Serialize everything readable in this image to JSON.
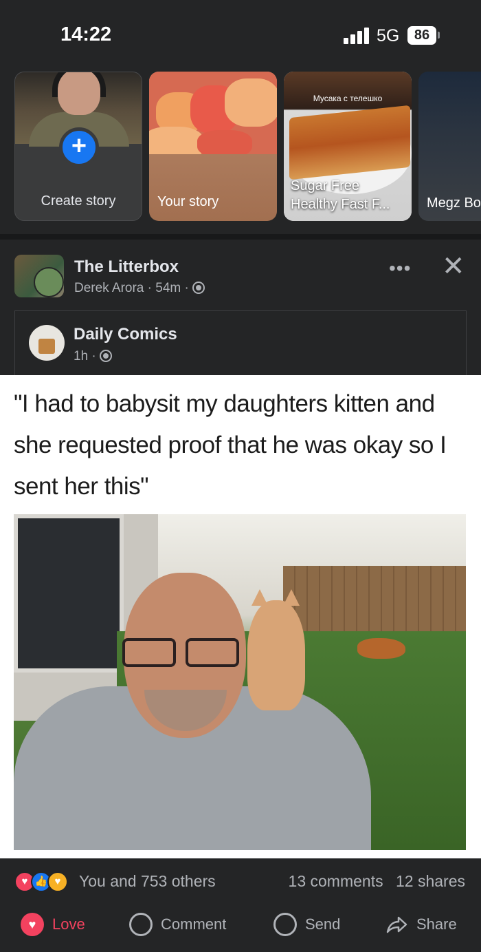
{
  "status_bar": {
    "time": "14:22",
    "network": "5G",
    "battery": "86"
  },
  "stories": {
    "create_label": "Create story",
    "your_story_label": "Your story",
    "sugar_caption": "Мусака с телешко",
    "sugar_label_line1": "Sugar Free",
    "sugar_label_line2": "Healthy Fast F...",
    "megz_label": "Megz Bo"
  },
  "post": {
    "group_name": "The Litterbox",
    "author": "Derek Arora",
    "time": "54m",
    "shared": {
      "page_name": "Daily Comics",
      "time": "1h"
    },
    "meme_text": "\"I had to babysit my daughters kitten and she requested proof that he was okay so I sent her this\"",
    "reactions_text": "You and 753 others",
    "comments": "13 comments",
    "shares": "12 shares",
    "actions": {
      "love": "Love",
      "comment": "Comment",
      "send": "Send",
      "share": "Share"
    }
  },
  "colors": {
    "background": "#242526",
    "accent_blue": "#1877f2",
    "love_red": "#f3425f",
    "secondary_text": "#b0b3b8"
  },
  "icons": [
    "signal-icon",
    "battery-icon",
    "plus-icon",
    "globe-icon",
    "more-icon",
    "close-icon",
    "love-reaction-icon",
    "like-reaction-icon",
    "care-reaction-icon",
    "heart-icon",
    "comment-icon",
    "messenger-icon",
    "share-arrow-icon"
  ]
}
